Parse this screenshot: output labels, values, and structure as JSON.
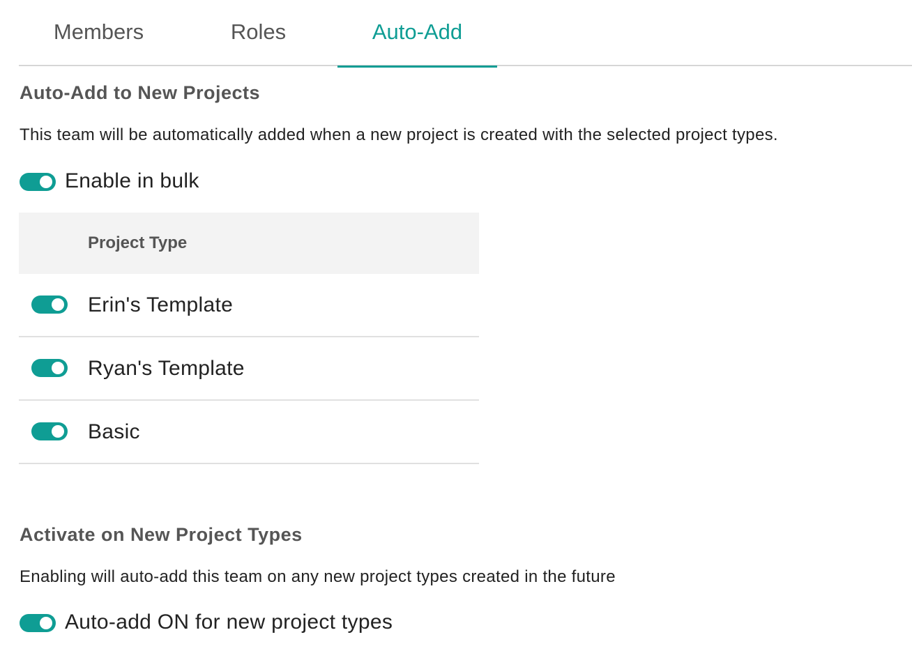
{
  "tabs": [
    {
      "label": "Members",
      "active": false
    },
    {
      "label": "Roles",
      "active": false
    },
    {
      "label": "Auto-Add",
      "active": true
    }
  ],
  "auto_add": {
    "title": "Auto-Add to New Projects",
    "description": "This team will be automatically added when a new project is created with the selected project types.",
    "bulk_toggle": {
      "label": "Enable in bulk",
      "on": true
    },
    "table": {
      "header": "Project Type",
      "rows": [
        {
          "label": "Erin's Template",
          "on": true
        },
        {
          "label": "Ryan's Template",
          "on": true
        },
        {
          "label": "Basic",
          "on": true
        }
      ]
    }
  },
  "activate": {
    "title": "Activate on New Project Types",
    "description": "Enabling will auto-add this team on any new project types created in the future",
    "toggle": {
      "label": "Auto-add ON for new project types",
      "on": true
    }
  },
  "colors": {
    "accent": "#0f9d94",
    "header_bg": "#f3f3f3",
    "muted_text": "#555555"
  }
}
